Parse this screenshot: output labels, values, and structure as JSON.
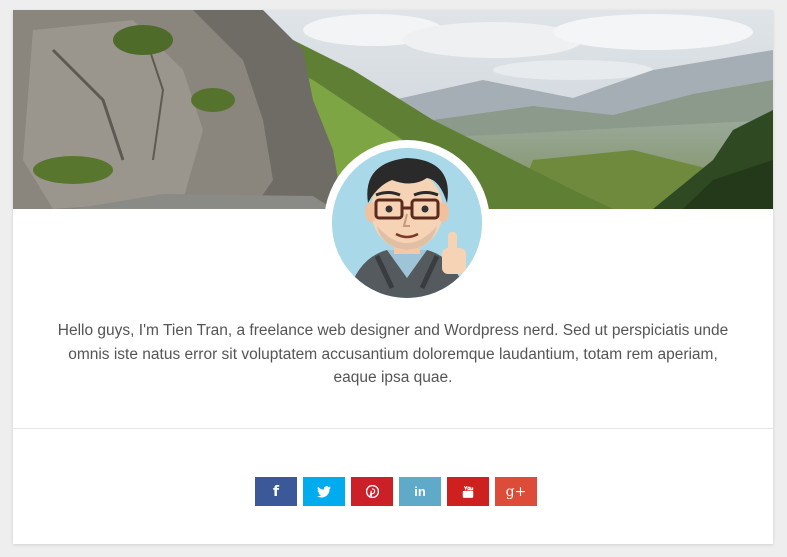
{
  "profile": {
    "bio": "Hello guys, I'm Tien Tran, a freelance web designer and Wordpress nerd. Sed ut perspiciatis unde omnis iste natus error sit voluptatem accusantium doloremque laudantium, totam rem aperiam, eaque ipsa quae."
  },
  "social": [
    {
      "name": "facebook",
      "icon": "facebook-icon",
      "glyph": "f",
      "color": "#3b5998"
    },
    {
      "name": "twitter",
      "icon": "twitter-icon",
      "glyph": "",
      "color": "#00aced"
    },
    {
      "name": "pinterest",
      "icon": "pinterest-icon",
      "glyph": "",
      "color": "#cb2027"
    },
    {
      "name": "linkedin",
      "icon": "linkedin-icon",
      "glyph": "in",
      "color": "#5fa9c9"
    },
    {
      "name": "youtube",
      "icon": "youtube-icon",
      "glyph": "",
      "color": "#cd201f"
    },
    {
      "name": "google-plus",
      "icon": "google-plus-icon",
      "glyph": "g+",
      "color": "#dd4b39"
    }
  ]
}
